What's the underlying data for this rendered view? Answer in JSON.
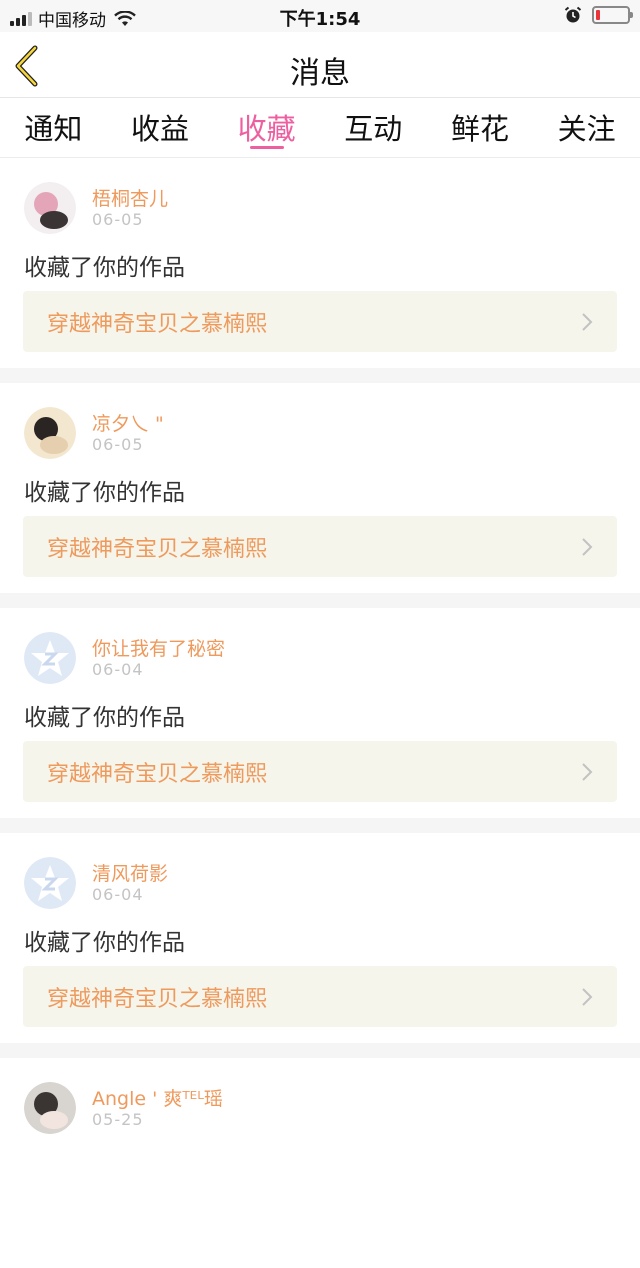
{
  "status_bar": {
    "carrier": "中国移动",
    "time": "下午1:54",
    "battery_level": 0.12,
    "battery_color": "#e8343a"
  },
  "header": {
    "title": "消息",
    "back_icon": "chevron-left-icon"
  },
  "tabs": [
    {
      "label": "通知",
      "active": false
    },
    {
      "label": "收益",
      "active": false
    },
    {
      "label": "收藏",
      "active": true
    },
    {
      "label": "互动",
      "active": false
    },
    {
      "label": "鲜花",
      "active": false
    },
    {
      "label": "关注",
      "active": false
    }
  ],
  "colors": {
    "accent_tab": "#ee5fa0",
    "username": "#ef9a5d",
    "work_title": "#ef9a5d",
    "work_box_bg": "#f5f5ec"
  },
  "notifications": [
    {
      "username": "梧桐杏儿",
      "date": "06-05",
      "action": "收藏了你的作品",
      "work_title": "穿越神奇宝贝之慕楠熙",
      "avatar": "photo-avatar"
    },
    {
      "username": "凉夕乀 \"",
      "date": "06-05",
      "action": "收藏了你的作品",
      "work_title": "穿越神奇宝贝之慕楠熙",
      "avatar": "photo-avatar"
    },
    {
      "username": "你让我有了秘密",
      "date": "06-04",
      "action": "收藏了你的作品",
      "work_title": "穿越神奇宝贝之慕楠熙",
      "avatar": "default-qq-avatar"
    },
    {
      "username": "清风荷影",
      "date": "06-04",
      "action": "收藏了你的作品",
      "work_title": "穿越神奇宝贝之慕楠熙",
      "avatar": "default-qq-avatar"
    },
    {
      "username": "Angle ' 爽ᵀᴱᴸ瑶",
      "date": "05-25",
      "action": "",
      "work_title": "",
      "avatar": "photo-avatar"
    }
  ]
}
